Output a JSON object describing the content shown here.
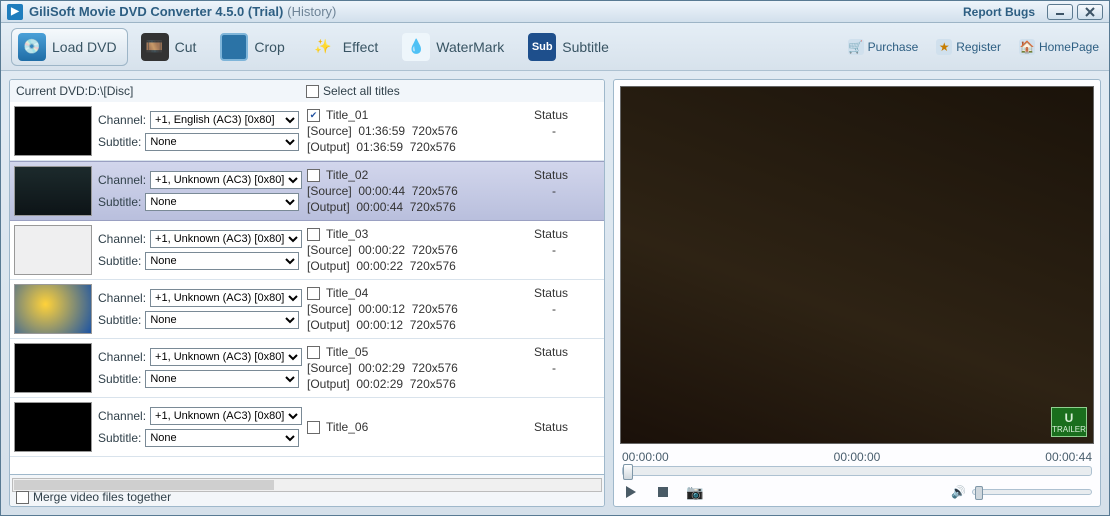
{
  "title": {
    "main": "GiliSoft Movie DVD Converter 4.5.0 (Trial)",
    "sub": "(History)",
    "report": "Report Bugs"
  },
  "toolbar": {
    "load_dvd": "Load DVD",
    "cut": "Cut",
    "crop": "Crop",
    "effect": "Effect",
    "watermark": "WaterMark",
    "subtitle": "Subtitle",
    "purchase": "Purchase",
    "register": "Register",
    "homepage": "HomePage"
  },
  "left": {
    "current_dvd_prefix": "Current DVD:",
    "current_dvd_path": "D:\\[Disc]",
    "select_all": "Select all titles",
    "merge": "Merge video files together",
    "labels": {
      "channel": "Channel:",
      "subtitle": "Subtitle:",
      "source": "[Source]",
      "output": "[Output]",
      "status": "Status"
    },
    "rows": [
      {
        "thumb": "black",
        "channel": "+1, English (AC3) [0x80]",
        "subtitle": "None",
        "checked": true,
        "title": "Title_01",
        "src_time": "01:36:59",
        "src_res": "720x576",
        "out_time": "01:36:59",
        "out_res": "720x576",
        "status": "-",
        "selected": false
      },
      {
        "thumb": "scene",
        "channel": "+1, Unknown (AC3) [0x80]",
        "subtitle": "None",
        "checked": false,
        "title": "Title_02",
        "src_time": "00:00:44",
        "src_res": "720x576",
        "out_time": "00:00:44",
        "out_res": "720x576",
        "status": "-",
        "selected": true
      },
      {
        "thumb": "grey",
        "channel": "+1, Unknown (AC3) [0x80]",
        "subtitle": "None",
        "checked": false,
        "title": "Title_03",
        "src_time": "00:00:22",
        "src_res": "720x576",
        "out_time": "00:00:22",
        "out_res": "720x576",
        "status": "-",
        "selected": false
      },
      {
        "thumb": "globe",
        "channel": "+1, Unknown (AC3) [0x80]",
        "subtitle": "None",
        "checked": false,
        "title": "Title_04",
        "src_time": "00:00:12",
        "src_res": "720x576",
        "out_time": "00:00:12",
        "out_res": "720x576",
        "status": "-",
        "selected": false
      },
      {
        "thumb": "black",
        "channel": "+1, Unknown (AC3) [0x80]",
        "subtitle": "None",
        "checked": false,
        "title": "Title_05",
        "src_time": "00:02:29",
        "src_res": "720x576",
        "out_time": "00:02:29",
        "out_res": "720x576",
        "status": "-",
        "selected": false
      },
      {
        "thumb": "black",
        "channel": "+1, Unknown (AC3) [0x80]",
        "subtitle": "None",
        "checked": false,
        "title": "Title_06",
        "src_time": "",
        "src_res": "",
        "out_time": "",
        "out_res": "",
        "status": "-",
        "selected": false
      }
    ]
  },
  "player": {
    "time_left": "00:00:00",
    "time_mid": "00:00:00",
    "time_right": "00:00:44",
    "rating_top": "U",
    "rating_bottom": "TRAILER"
  }
}
